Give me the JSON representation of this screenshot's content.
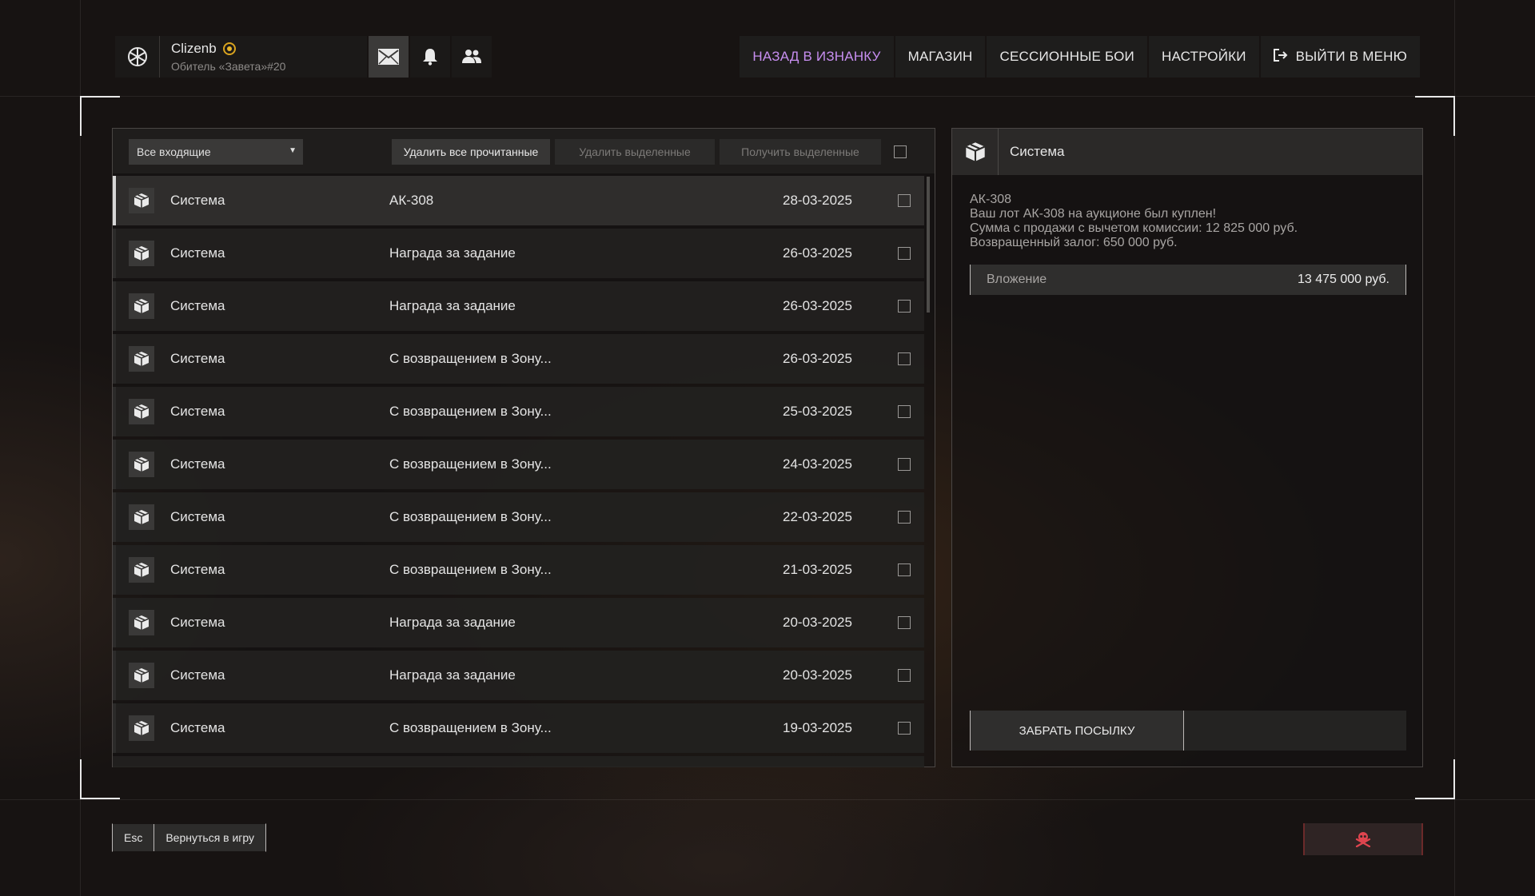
{
  "profile": {
    "name": "Clizenb",
    "subtitle": "Обитель «Завета»#20"
  },
  "topnav": {
    "back": "НАЗАД В ИЗНАНКУ",
    "shop": "МАГАЗИН",
    "sessions": "СЕССИОННЫЕ БОИ",
    "settings": "НАСТРОЙКИ",
    "exit": "ВЫЙТИ В МЕНЮ"
  },
  "toolbar": {
    "filter": "Все входящие",
    "delete_read": "Удалить все прочитанные",
    "delete_selected": "Удалить выделенные",
    "get_selected": "Получить выделенные"
  },
  "messages": [
    {
      "from": "Система",
      "subject": "АК-308",
      "date": "28-03-2025"
    },
    {
      "from": "Система",
      "subject": "Награда за задание",
      "date": "26-03-2025"
    },
    {
      "from": "Система",
      "subject": "Награда за задание",
      "date": "26-03-2025"
    },
    {
      "from": "Система",
      "subject": "С возвращением в Зону...",
      "date": "26-03-2025"
    },
    {
      "from": "Система",
      "subject": "С возвращением в Зону...",
      "date": "25-03-2025"
    },
    {
      "from": "Система",
      "subject": "С возвращением в Зону...",
      "date": "24-03-2025"
    },
    {
      "from": "Система",
      "subject": "С возвращением в Зону...",
      "date": "22-03-2025"
    },
    {
      "from": "Система",
      "subject": "С возвращением в Зону...",
      "date": "21-03-2025"
    },
    {
      "from": "Система",
      "subject": "Награда за задание",
      "date": "20-03-2025"
    },
    {
      "from": "Система",
      "subject": "Награда за задание",
      "date": "20-03-2025"
    },
    {
      "from": "Система",
      "subject": "С возвращением в Зону...",
      "date": "19-03-2025"
    }
  ],
  "detail": {
    "sender": "Система",
    "lines": [
      "АК-308",
      "Ваш лот АК-308 на аукционе был куплен!",
      "Сумма с продажи с вычетом комиссии: 12 825 000 руб.",
      "Возвращенный залог: 650 000 руб."
    ],
    "attachment_label": "Вложение",
    "attachment_value": "13 475 000 руб.",
    "claim_button": "ЗАБРАТЬ ПОСЫЛКУ"
  },
  "bottom": {
    "esc_key": "Esc",
    "esc_label": "Вернуться в игру"
  },
  "colors": {
    "accent": "#c78ef0",
    "badge": "#e9b62b",
    "danger": "#e0454f"
  }
}
